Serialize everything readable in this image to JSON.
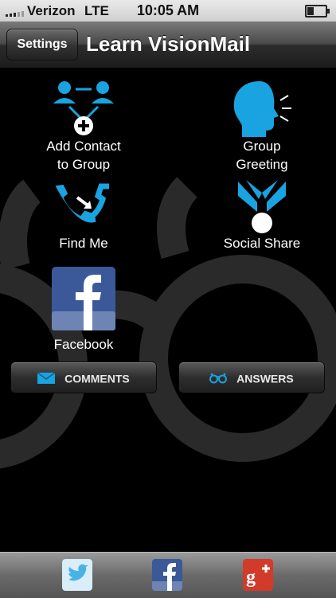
{
  "status_bar": {
    "carrier": "Verizon",
    "network": "LTE",
    "time": "10:05 AM",
    "battery_level": 0.4
  },
  "nav": {
    "settings_label": "Settings",
    "title": "Learn VisionMail"
  },
  "tiles": {
    "add_contact": {
      "line1": "Add Contact",
      "line2": "to Group",
      "icon": "add-contact-group-icon"
    },
    "group_greeting": {
      "line1": "Group",
      "line2": "Greeting",
      "icon": "speaking-head-icon"
    },
    "find_me": {
      "label": "Find Me",
      "icon": "phone-forward-icon"
    },
    "social_share": {
      "label": "Social Share",
      "icon": "social-share-icon"
    },
    "facebook": {
      "label": "Facebook",
      "icon": "facebook-icon"
    }
  },
  "buttons": {
    "comments": {
      "label": "COMMENTS",
      "icon": "envelope-icon"
    },
    "answers": {
      "label": "ANSWERS",
      "icon": "glasses-icon"
    }
  },
  "tab_bar": {
    "items": [
      "twitter-icon",
      "facebook-icon",
      "google-plus-icon"
    ]
  },
  "colors": {
    "accent": "#19a3e0",
    "facebook": "#3b5998",
    "google_plus": "#d23b2a",
    "twitter": "#4ab3e6"
  }
}
